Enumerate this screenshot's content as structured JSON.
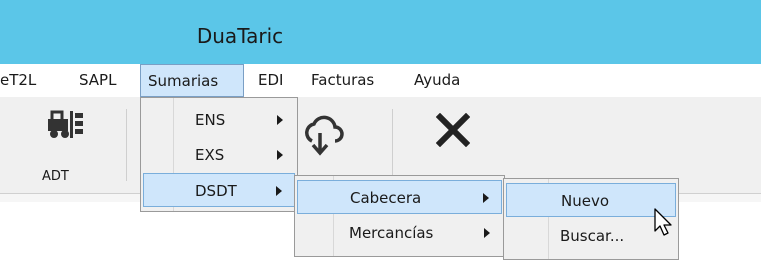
{
  "window": {
    "title": "DuaTaric"
  },
  "menubar": {
    "items": [
      {
        "label": "eT2L"
      },
      {
        "label": "SAPL"
      },
      {
        "label": "Sumarias"
      },
      {
        "label": "EDI"
      },
      {
        "label": "Facturas"
      },
      {
        "label": "Ayuda"
      }
    ]
  },
  "toolbar": {
    "buttons": [
      {
        "label": "ADT",
        "icon": "forklift-icon"
      },
      {
        "label": "",
        "icon": "cloud-download-icon"
      },
      {
        "label": "",
        "icon": "close-icon"
      }
    ]
  },
  "menus": {
    "sumarias": [
      {
        "label": "ENS"
      },
      {
        "label": "EXS"
      },
      {
        "label": "DSDT"
      }
    ],
    "dsdt": [
      {
        "label": "Cabecera"
      },
      {
        "label": "Mercancías"
      }
    ],
    "cabecera": [
      {
        "label": "Nuevo"
      },
      {
        "label": "Buscar..."
      }
    ]
  },
  "colors": {
    "titlebar": "#5bc6e8",
    "highlight": "#cfe6fb",
    "highlight_border": "#7aaedb"
  }
}
